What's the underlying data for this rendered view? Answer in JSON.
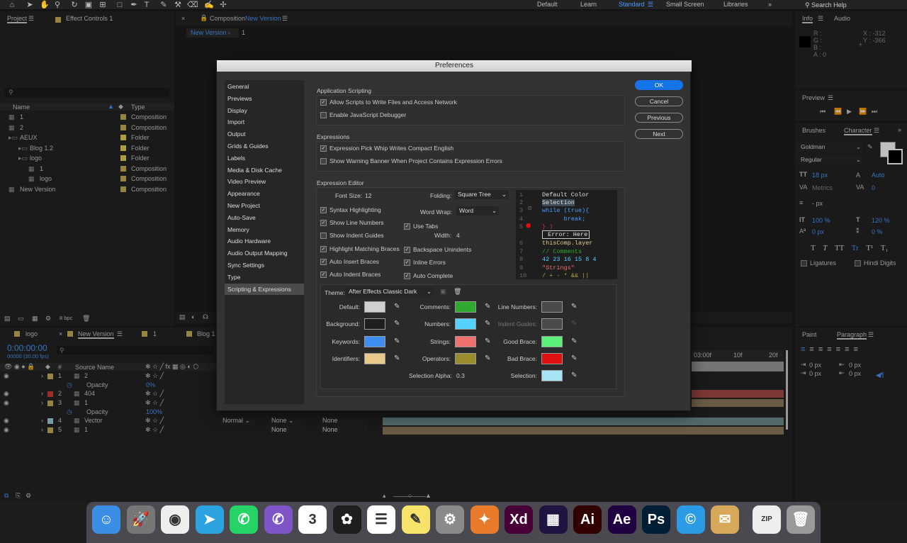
{
  "topbar": {
    "workspaces": [
      "Default",
      "Learn",
      "Standard",
      "Small Screen",
      "Libraries"
    ],
    "search": "Search Help"
  },
  "project": {
    "tab": "Project",
    "effects": "Effect Controls 1",
    "col_name": "Name",
    "col_type": "Type",
    "items": [
      {
        "name": "1",
        "type": "Composition",
        "indent": 0,
        "color": "#c9b05a"
      },
      {
        "name": "2",
        "type": "Composition",
        "indent": 0,
        "color": "#c9b05a"
      },
      {
        "name": "AEUX",
        "type": "Folder",
        "indent": 0,
        "color": "#e8d44d"
      },
      {
        "name": "Blog 1.2",
        "type": "Folder",
        "indent": 1,
        "color": "#e8d44d"
      },
      {
        "name": "logo",
        "type": "Folder",
        "indent": 1,
        "color": "#e8d44d"
      },
      {
        "name": "1",
        "type": "Composition",
        "indent": 2,
        "color": "#c9b05a"
      },
      {
        "name": "logo",
        "type": "Composition",
        "indent": 2,
        "color": "#c9b05a"
      },
      {
        "name": "New Version",
        "type": "Composition",
        "indent": 0,
        "color": "#c9b05a"
      }
    ],
    "bpc": "8 bpc"
  },
  "comp": {
    "tab_prefix": "Composition",
    "tab_name": "New Version",
    "crumb": "New Version",
    "crumb2": "1"
  },
  "info": {
    "tab": "Info",
    "tab2": "Audio",
    "r": "R :",
    "g": "G :",
    "b": "B :",
    "a": "A : 0",
    "x": "X : -312",
    "y": "Y : -366"
  },
  "preview": {
    "tab": "Preview"
  },
  "character": {
    "brushes": "Brushes",
    "tab": "Character",
    "font": "Goldman",
    "style": "Regular",
    "size": "18 px",
    "leading": "Auto",
    "metrics": "Metrics",
    "tracking": "0",
    "stroke": "- px",
    "vscale": "100 %",
    "hscale": "120 %",
    "baseline": "0 px",
    "tsume": "0 %",
    "ligatures": "Ligatures",
    "hindi": "Hindi Digits"
  },
  "paragraph": {
    "paint": "Paint",
    "tab": "Paragraph",
    "v1": "0 px",
    "v2": "0 px",
    "v3": "0 px",
    "v4": "0 px"
  },
  "timeline": {
    "tabs": [
      "logo",
      "New Version",
      "1",
      "Blog 1"
    ],
    "time": "0:00:00:00",
    "fps": "00000 (30.00 fps)",
    "source_col": "Source Name",
    "hash": "#",
    "layers": [
      {
        "num": "1",
        "name": "2",
        "color": "#c9b05a"
      },
      {
        "prop": "Opacity",
        "val": "0%"
      },
      {
        "num": "2",
        "name": "404",
        "color": "#d23b3b"
      },
      {
        "num": "3",
        "name": "1",
        "color": "#c9b05a"
      },
      {
        "prop": "Opacity",
        "val": "100%"
      },
      {
        "num": "4",
        "name": "Vector",
        "color": "#9fd2d8"
      },
      {
        "num": "5",
        "name": "1",
        "color": "#c9b05a"
      }
    ],
    "mode": "Normal",
    "none": "None",
    "ruler": [
      "03:00f",
      "10f",
      "20f"
    ]
  },
  "prefs": {
    "title": "Preferences",
    "nav": [
      "General",
      "Previews",
      "Display",
      "Import",
      "Output",
      "Grids & Guides",
      "Labels",
      "Media & Disk Cache",
      "Video Preview",
      "Appearance",
      "New Project",
      "Auto-Save",
      "Memory",
      "Audio Hardware",
      "Audio Output Mapping",
      "Sync Settings",
      "Type",
      "Scripting & Expressions"
    ],
    "buttons": {
      "ok": "OK",
      "cancel": "Cancel",
      "previous": "Previous",
      "next": "Next"
    },
    "app_scripting": {
      "label": "Application Scripting",
      "allow": "Allow Scripts to Write Files and Access Network",
      "debugger": "Enable JavaScript Debugger"
    },
    "expressions": {
      "label": "Expressions",
      "pickwhip": "Expression Pick Whip Writes Compact English",
      "warning": "Show Warning Banner When Project Contains Expression Errors"
    },
    "editor": {
      "label": "Expression Editor",
      "font_size_label": "Font Size:",
      "font_size": "12",
      "folding_label": "Folding:",
      "folding": "Square Tree",
      "wordwrap_label": "Word Wrap:",
      "wordwrap": "Word",
      "use_tabs": "Use Tabs",
      "width_label": "Width:",
      "width": "4",
      "syntax": "Syntax Highlighting",
      "line_numbers": "Show Line Numbers",
      "indent_guides": "Show Indent Guides",
      "matching": "Highlight Matching Braces",
      "auto_insert": "Auto Insert Braces",
      "auto_indent": "Auto Indent Braces",
      "backspace": "Backspace Unindents",
      "inline_errors": "Inline Errors",
      "autocomplete": "Auto Complete"
    },
    "code_lines": [
      {
        "n": "1",
        "t": "Default Color",
        "c": "#e0e0e0"
      },
      {
        "n": "2",
        "t": "Selection",
        "c": "#e0e0e0"
      },
      {
        "n": "3",
        "t": "while (true){",
        "c": "#4a9bff"
      },
      {
        "n": "4",
        "t": "      break;",
        "c": "#4a9bff"
      },
      {
        "n": "5",
        "t": "} )",
        "c": "#e03030"
      },
      {
        "n": "",
        "t": " Error: Here",
        "c": "#e0e0e0"
      },
      {
        "n": "6",
        "t": "thisComp.layer",
        "c": "#e8c98a"
      },
      {
        "n": "7",
        "t": "// Comments",
        "c": "#2eaa2e"
      },
      {
        "n": "8",
        "t": "42 23 16 15 8 4",
        "c": "#55d1ff"
      },
      {
        "n": "9",
        "t": "\"Strings\"",
        "c": "#f07070"
      },
      {
        "n": "10",
        "t": "/ + - * && ||",
        "c": "#b0a040"
      }
    ],
    "theme": {
      "label": "Theme:",
      "value": "After Effects Classic Dark",
      "default": "Default:",
      "background": "Background:",
      "keywords": "Keywords:",
      "identifiers": "Identifiers:",
      "comments": "Comments:",
      "numbers": "Numbers:",
      "strings": "Strings:",
      "operators": "Operators:",
      "line_numbers": "Line Numbers:",
      "indent_guides": "Indent Guides:",
      "good_brace": "Good Brace:",
      "bad_brace": "Bad Brace:",
      "sel_alpha_label": "Selection Alpha:",
      "sel_alpha": "0.3",
      "selection": "Selection:"
    },
    "colors": {
      "default": "#cfcfcf",
      "background": "#1e1e1e",
      "keywords": "#3d8ef0",
      "identifiers": "#e8c98a",
      "comments": "#2eaa2e",
      "numbers": "#55d1ff",
      "strings": "#f07070",
      "operators": "#9a8c2a",
      "line_numbers": "#4a4a4a",
      "indent_guides": "#4a4a4a",
      "good_brace": "#5af07a",
      "bad_brace": "#e01010",
      "selection": "#a8e2f5"
    }
  },
  "dock": [
    {
      "name": "finder-icon",
      "label": "☺",
      "bg": "#3a8ee6"
    },
    {
      "name": "launchpad-icon",
      "label": "🚀",
      "bg": "#777"
    },
    {
      "name": "chrome-icon",
      "label": "◉",
      "bg": "#eee"
    },
    {
      "name": "telegram-icon",
      "label": "➤",
      "bg": "#2aa3e0"
    },
    {
      "name": "whatsapp-icon",
      "label": "✆",
      "bg": "#25d366"
    },
    {
      "name": "viber-icon",
      "label": "✆",
      "bg": "#7d55c7"
    },
    {
      "name": "calendar-icon",
      "label": "3",
      "bg": "#fff"
    },
    {
      "name": "figma-icon",
      "label": "✿",
      "bg": "#1e1e1e"
    },
    {
      "name": "reminders-icon",
      "label": "☰",
      "bg": "#fff"
    },
    {
      "name": "notes-icon",
      "label": "✎",
      "bg": "#f7e36a"
    },
    {
      "name": "system-preferences-icon",
      "label": "⚙",
      "bg": "#8a8a8a"
    },
    {
      "name": "rocket-typist-icon",
      "label": "✦",
      "bg": "#e87a2a"
    },
    {
      "name": "adobe-xd-icon",
      "label": "Xd",
      "bg": "#470137"
    },
    {
      "name": "media-encoder-icon",
      "label": "▦",
      "bg": "#1f1441"
    },
    {
      "name": "illustrator-icon",
      "label": "Ai",
      "bg": "#330000"
    },
    {
      "name": "after-effects-icon",
      "label": "Ae",
      "bg": "#1f0040"
    },
    {
      "name": "photoshop-icon",
      "label": "Ps",
      "bg": "#001e36"
    },
    {
      "name": "creative-cloud-icon",
      "label": "©",
      "bg": "#2b9be6"
    },
    {
      "name": "preview-icon",
      "label": "✉",
      "bg": "#d7a85a"
    },
    {
      "name": "archive-icon",
      "label": "ZIP",
      "bg": "#eee"
    },
    {
      "name": "trash-icon",
      "label": "🗑",
      "bg": "#999"
    }
  ]
}
